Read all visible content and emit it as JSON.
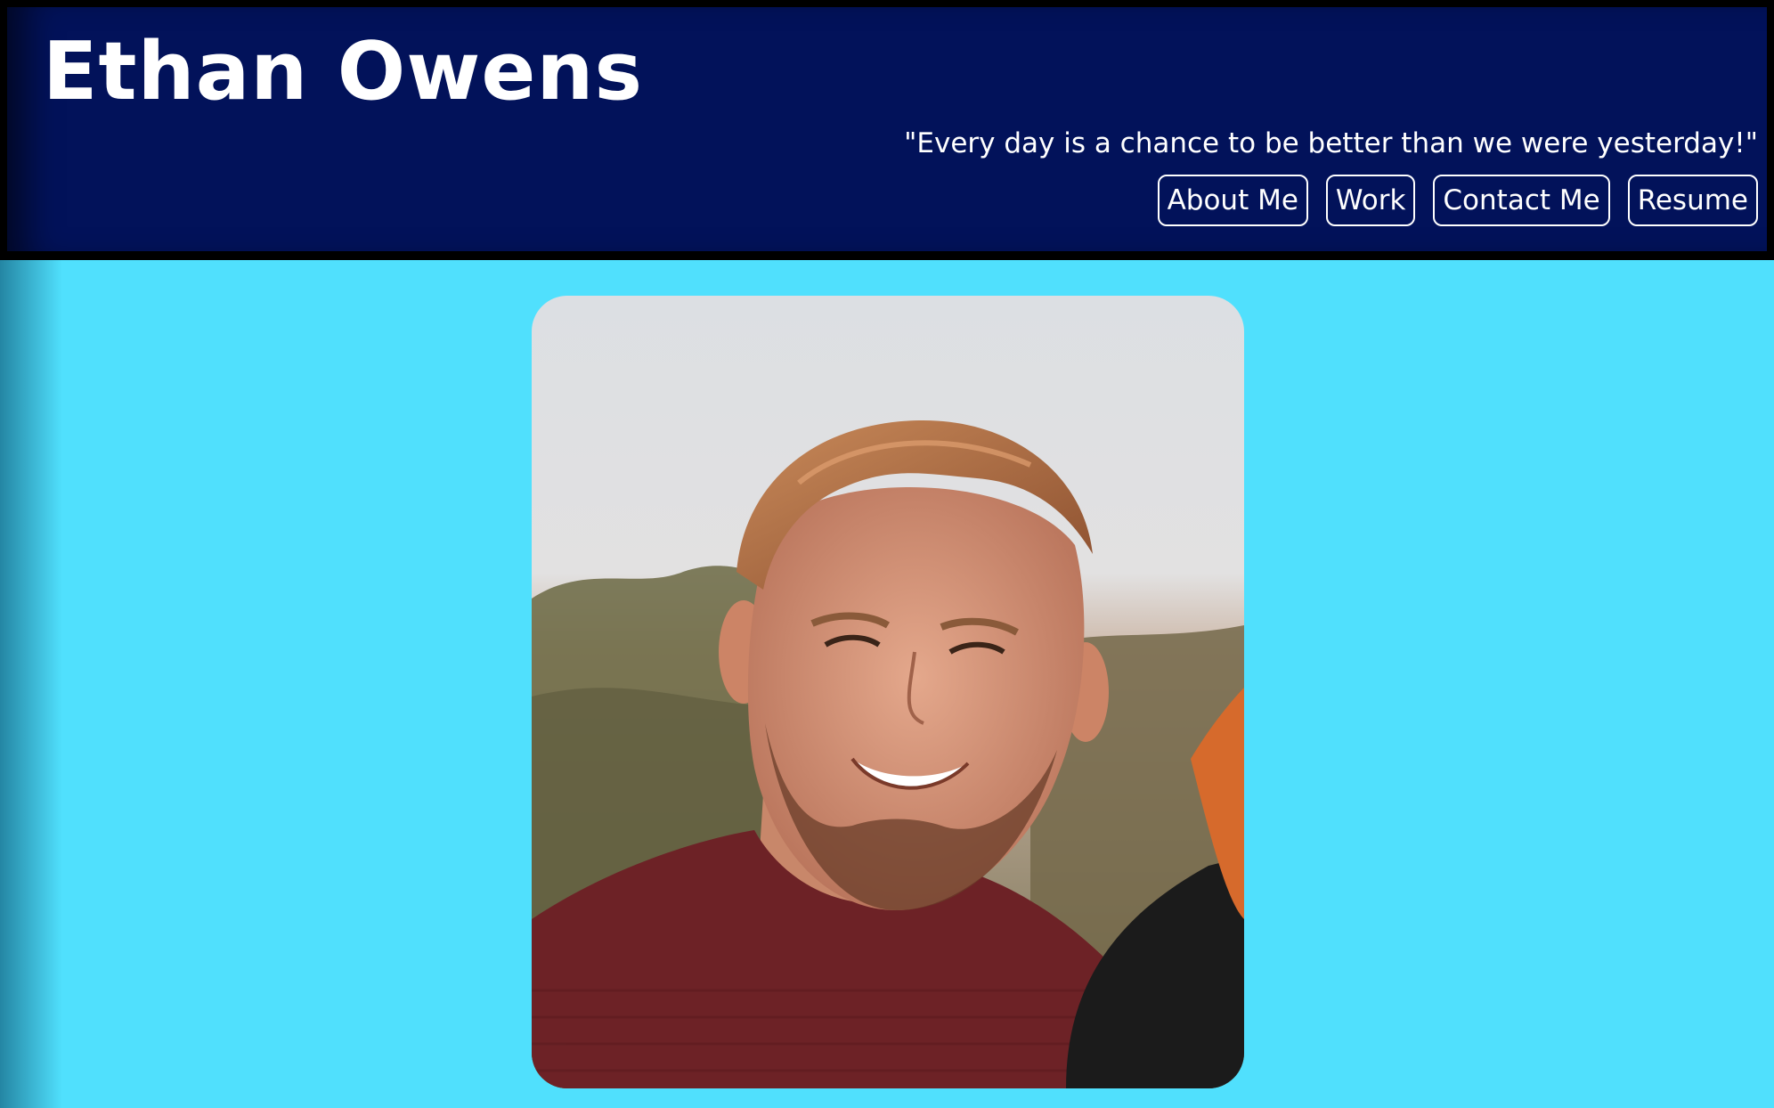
{
  "header": {
    "title": "Ethan Owens",
    "tagline": "\"Every day is a chance to be better than we were yesterday!\""
  },
  "nav": {
    "items": [
      {
        "label": "About Me",
        "name": "nav-link-about-me"
      },
      {
        "label": "Work",
        "name": "nav-link-work"
      },
      {
        "label": "Contact Me",
        "name": "nav-link-contact-me"
      },
      {
        "label": "Resume",
        "name": "nav-link-resume"
      }
    ]
  },
  "colors": {
    "header_background": "#02125a",
    "header_border": "#000000",
    "page_background": "#50e0fd",
    "text": "#ffffff"
  },
  "main": {
    "photo_icon": "profile-photo"
  }
}
